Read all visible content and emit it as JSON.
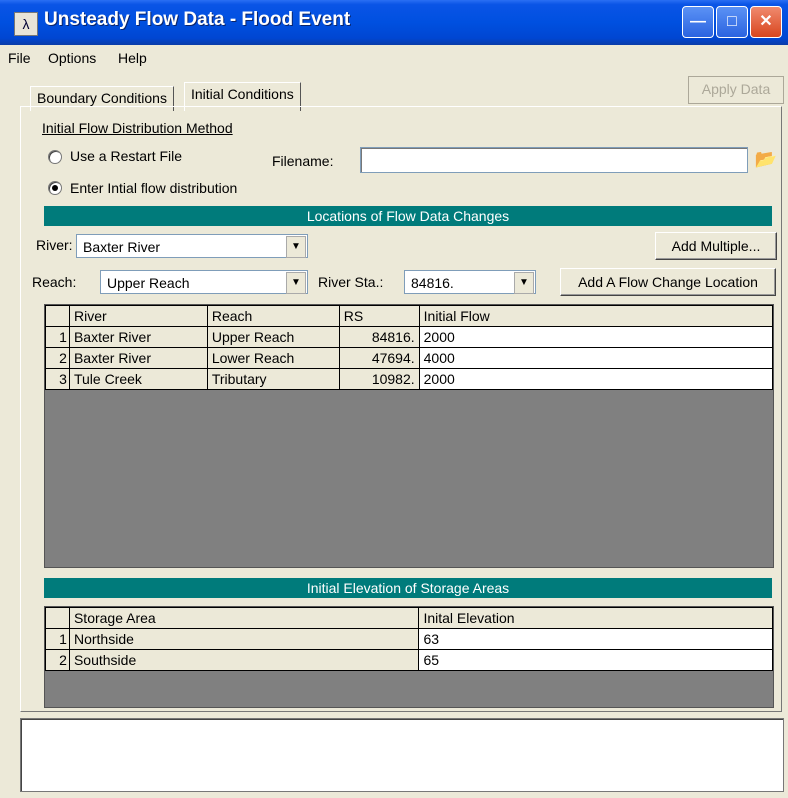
{
  "window": {
    "title": "Unsteady Flow Data - Flood Event"
  },
  "menu": {
    "items": [
      "File",
      "Options",
      "Help"
    ]
  },
  "tabs": [
    {
      "label": "Boundary Conditions"
    },
    {
      "label": "Initial Conditions"
    }
  ],
  "apply_label": "Apply Data",
  "init_method": {
    "heading": "Initial Flow Distribution Method",
    "restart_label": "Use a Restart File",
    "filename_label": "Filename:",
    "filename_value": "",
    "enter_label": "Enter Intial flow distribution",
    "selected": "enter"
  },
  "flow": {
    "header": "Locations of Flow Data Changes",
    "river_label": "River:",
    "river_value": "Baxter River",
    "reach_label": "Reach:",
    "reach_value": "Upper Reach",
    "sta_label": "River Sta.:",
    "sta_value": "84816.",
    "add_multiple_label": "Add Multiple...",
    "add_location_label": "Add A Flow Change Location",
    "columns": [
      "River",
      "Reach",
      "RS",
      "Initial Flow"
    ],
    "rows": [
      {
        "n": "1",
        "river": "Baxter River",
        "reach": "Upper Reach",
        "rs": "84816.",
        "flow": "2000"
      },
      {
        "n": "2",
        "river": "Baxter River",
        "reach": "Lower Reach",
        "rs": "47694.",
        "flow": "4000"
      },
      {
        "n": "3",
        "river": "Tule Creek",
        "reach": "Tributary",
        "rs": "10982.",
        "flow": "2000"
      }
    ]
  },
  "storage": {
    "header": "Initial Elevation of Storage Areas",
    "columns": [
      "Storage Area",
      "Inital Elevation"
    ],
    "rows": [
      {
        "n": "1",
        "area": "Northside",
        "elev": "63"
      },
      {
        "n": "2",
        "area": "Southside",
        "elev": "65"
      }
    ]
  },
  "colors": {
    "section_header": "#007b7b",
    "grid_bg": "#808080",
    "titlebar": "#0050e0"
  },
  "icons": [
    "app-icon",
    "minimize-icon",
    "maximize-icon",
    "close-icon",
    "folder-open-icon",
    "chevron-down-icon"
  ]
}
